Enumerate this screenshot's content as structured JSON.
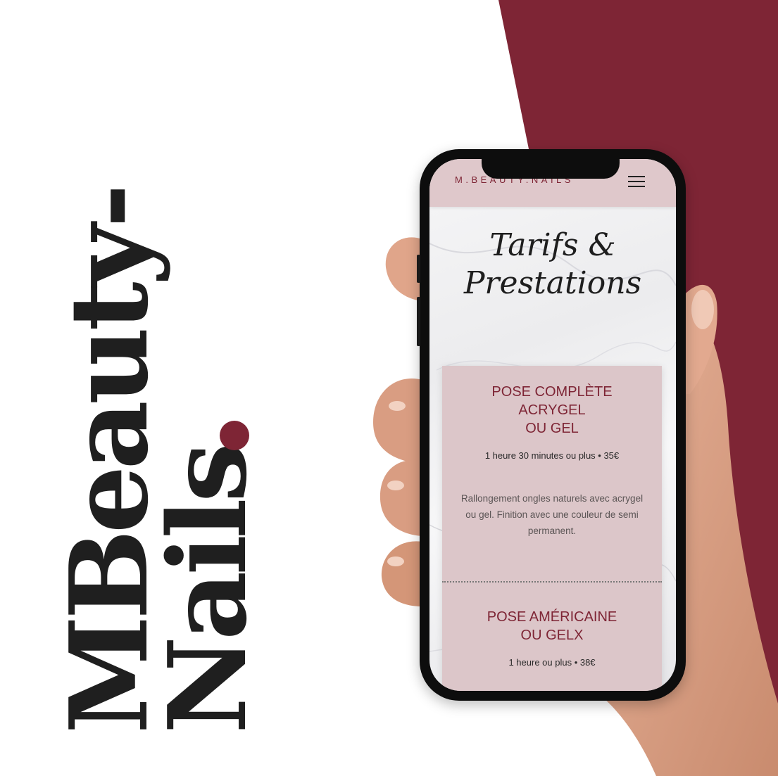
{
  "colors": {
    "accent": "#7e2535",
    "card": "#dcc6c9",
    "header": "#dfc8cb",
    "dark": "#1f1f1f"
  },
  "brand": {
    "line1": "MBeauty-",
    "line2": "Nails"
  },
  "site": {
    "logo": "M.BEAUTY.NAILS",
    "menu_icon": "hamburger-menu-icon",
    "title_line1": "Tarifs &",
    "title_line2": "Prestations"
  },
  "services": [
    {
      "title_line1": "POSE COMPLÈTE ACRYGEL",
      "title_line2": "OU GEL",
      "meta": "1 heure 30 minutes ou plus • 35€",
      "description": "Rallongement ongles naturels avec acrygel ou gel. Finition avec une couleur de semi permanent."
    },
    {
      "title_line1": "POSE AMÉRICAINE",
      "title_line2": "OU GELX",
      "meta": "1 heure ou plus • 38€"
    }
  ]
}
